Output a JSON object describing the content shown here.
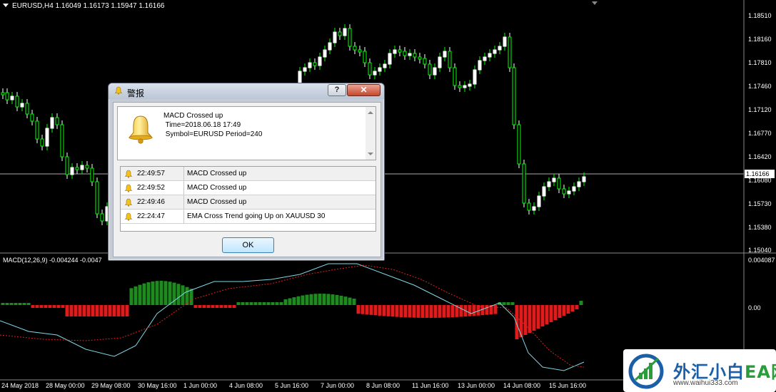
{
  "chart": {
    "title": "EURUSD,H4  1.16049 1.16173 1.15947 1.16166",
    "current_price": "1.16166",
    "price_axis": [
      "1.18510",
      "1.18160",
      "1.17810",
      "1.17460",
      "1.17120",
      "1.16770",
      "1.16420",
      "1.16080",
      "1.15730",
      "1.15380",
      "1.15040"
    ],
    "macd_title": "MACD(12,26,9) -0.004244 -0.0047",
    "macd_axis": [
      "0.004087",
      "0.00"
    ],
    "time_axis": [
      "24 May 2018",
      "28 May 00:00",
      "29 May 08:00",
      "30 May 16:00",
      "1 Jun 00:00",
      "4 Jun 08:00",
      "5 Jun 16:00",
      "7 Jun 00:00",
      "8 Jun 08:00",
      "11 Jun 16:00",
      "13 Jun 00:00",
      "14 Jun 08:00",
      "15 Jun 16:00"
    ],
    "colors": {
      "bull": "#ffffff",
      "bear": "#00ff00",
      "histogram_up": "#1f8a1f",
      "histogram_down": "#e01b1b",
      "macd_line": "#7fd8e6",
      "signal_line": "#e02020"
    }
  },
  "dialog": {
    "title": "警报",
    "help_label": "?",
    "close_label": "✕",
    "message_lines": [
      "MACD Crossed up",
      " Time=2018.06.18 17:49",
      " Symbol=EURUSD Period=240"
    ],
    "alerts": [
      {
        "time": "22:49:57",
        "message": "MACD Crossed up"
      },
      {
        "time": "22:49:52",
        "message": "MACD Crossed up"
      },
      {
        "time": "22:49:46",
        "message": "MACD Crossed up"
      },
      {
        "time": "22:24:47",
        "message": "EMA Cross Trend going Up on XAUUSD 30"
      }
    ],
    "ok_label": "OK",
    "icon": "bell-icon"
  },
  "watermark": {
    "text_main": "外汇小白",
    "text_ea": "EA网",
    "url": "www.waihui333.com"
  }
}
